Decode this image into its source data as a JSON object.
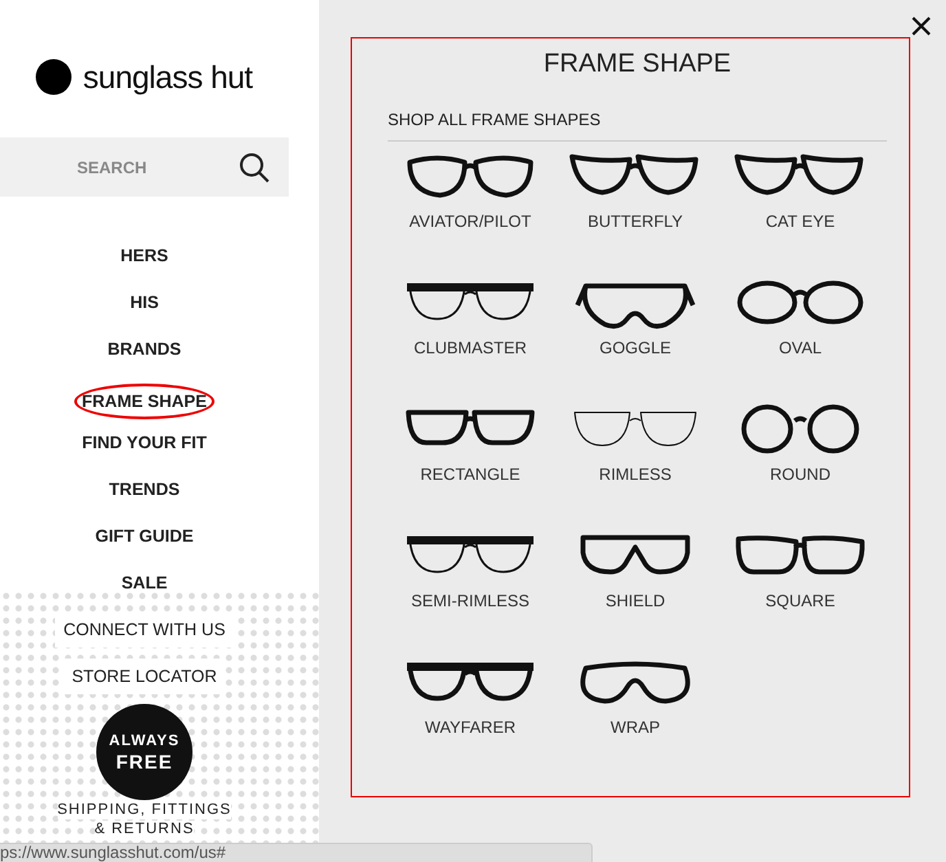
{
  "logo": {
    "text": "sunglass hut"
  },
  "search": {
    "placeholder": "SEARCH"
  },
  "nav": [
    {
      "label": "HERS",
      "kind": "primary",
      "highlighted": false
    },
    {
      "label": "HIS",
      "kind": "primary",
      "highlighted": false
    },
    {
      "label": "BRANDS",
      "kind": "primary",
      "highlighted": false
    },
    {
      "label": "FRAME SHAPE",
      "kind": "primary",
      "highlighted": true
    },
    {
      "label": "FIND YOUR FIT",
      "kind": "primary",
      "highlighted": false
    },
    {
      "label": "TRENDS",
      "kind": "primary",
      "highlighted": false
    },
    {
      "label": "GIFT GUIDE",
      "kind": "primary",
      "highlighted": false
    },
    {
      "label": "SALE",
      "kind": "primary",
      "highlighted": false
    },
    {
      "label": "CONNECT WITH US",
      "kind": "secondary",
      "highlighted": false
    },
    {
      "label": "STORE LOCATOR",
      "kind": "secondary",
      "highlighted": false
    }
  ],
  "promo": {
    "badge_lines": [
      "ALWAYS",
      "FREE"
    ],
    "caption_lines": [
      "SHIPPING, FITTINGS",
      "& RETURNS"
    ]
  },
  "panel": {
    "title": "FRAME SHAPE",
    "shop_all": "SHOP ALL FRAME SHAPES",
    "shapes": [
      {
        "label": "AVIATOR/PILOT"
      },
      {
        "label": "BUTTERFLY"
      },
      {
        "label": "CAT EYE"
      },
      {
        "label": "CLUBMASTER"
      },
      {
        "label": "GOGGLE"
      },
      {
        "label": "OVAL"
      },
      {
        "label": "RECTANGLE"
      },
      {
        "label": "RIMLESS"
      },
      {
        "label": "ROUND"
      },
      {
        "label": "SEMI-RIMLESS"
      },
      {
        "label": "SHIELD"
      },
      {
        "label": "SQUARE"
      },
      {
        "label": "WAYFARER"
      },
      {
        "label": "WRAP"
      }
    ]
  },
  "status_bar": "ps://www.sunglasshut.com/us#"
}
